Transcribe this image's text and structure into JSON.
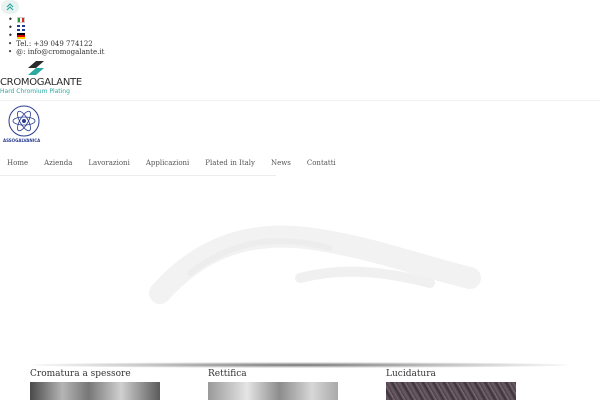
{
  "languages": [
    {
      "code": "it",
      "icon": "flag-italy-icon"
    },
    {
      "code": "en",
      "icon": "flag-uk-icon"
    },
    {
      "code": "de",
      "icon": "flag-germany-icon"
    }
  ],
  "contacts": {
    "phone": "Tel.: +39 049 774122",
    "email": "@: info@cromogalante.it"
  },
  "logo": {
    "name": "CROMOGALANTE",
    "tagline": "Hard Chromium Plating",
    "accent": "#2aa9a0"
  },
  "association": {
    "label": "ASSOGALVANICA"
  },
  "nav": {
    "items": [
      "Home",
      "Azienda",
      "Lavorazioni",
      "Applicazioni",
      "Plated in Italy",
      "News",
      "Contatti"
    ]
  },
  "cards": [
    {
      "title": "Cromatura a spessore"
    },
    {
      "title": "Rettifica"
    },
    {
      "title": "Lucidatura"
    }
  ]
}
